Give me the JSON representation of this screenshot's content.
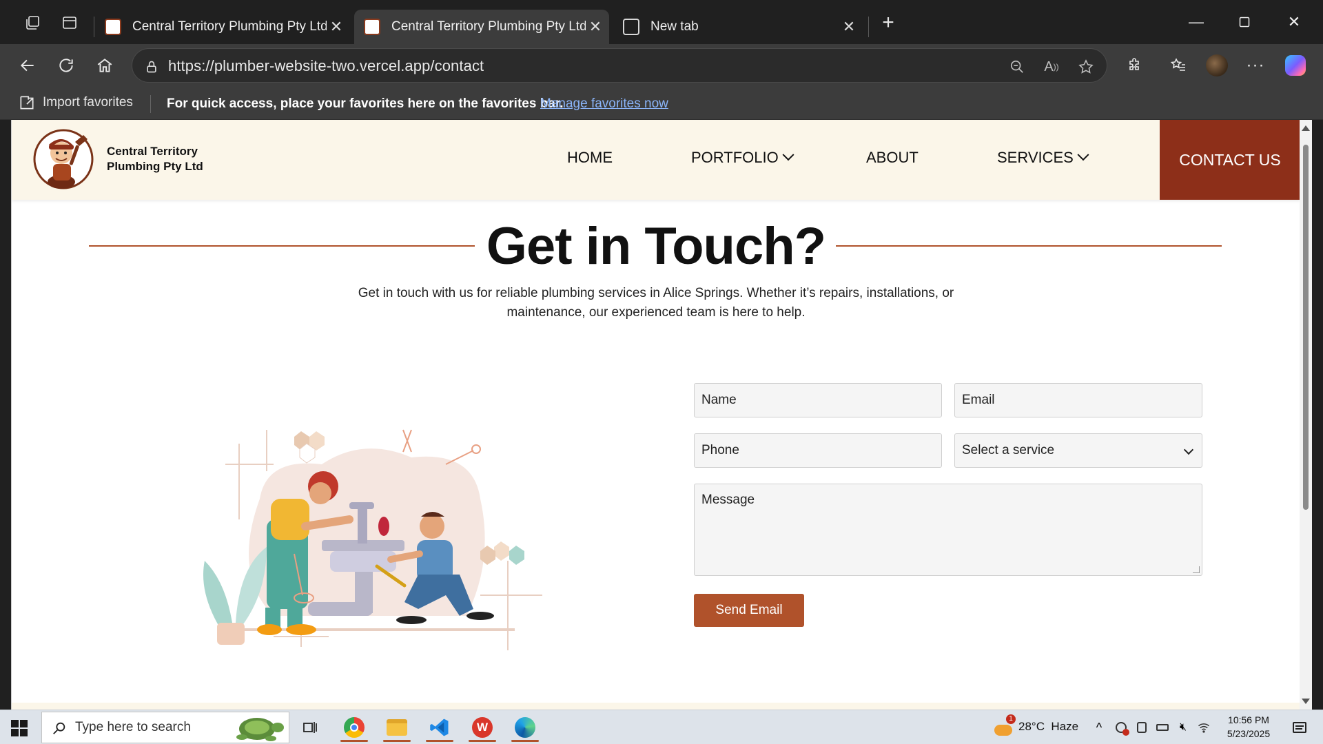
{
  "browser": {
    "tabs": [
      {
        "title": "Central Territory Plumbing Pty Ltd",
        "active": false
      },
      {
        "title": "Central Territory Plumbing Pty Ltd",
        "active": true
      },
      {
        "title": "New tab",
        "active": false
      }
    ],
    "url": "https://plumber-website-two.vercel.app/contact",
    "favorites_bar": {
      "import_label": "Import favorites",
      "hint": "For quick access, place your favorites here on the favorites bar.",
      "manage_link": "Manage favorites now"
    }
  },
  "site": {
    "brand_name_line1": "Central Territory",
    "brand_name_line2": "Plumbing Pty Ltd",
    "nav": {
      "home": "HOME",
      "portfolio": "PORTFOLIO",
      "about": "ABOUT",
      "services": "SERVICES",
      "contact": "CONTACT US"
    },
    "heading": "Get in Touch?",
    "description": "Get in touch with us for reliable plumbing services in Alice Springs. Whether it’s repairs, installations, or maintenance, our experienced team is here to help.",
    "form": {
      "name_placeholder": "Name",
      "email_placeholder": "Email",
      "phone_placeholder": "Phone",
      "service_selected": "Select a service",
      "message_placeholder": "Message",
      "submit_label": "Send Email"
    }
  },
  "taskbar": {
    "search_placeholder": "Type here to search",
    "weather": "28°C  Haze",
    "time": "10:56 PM",
    "date": "5/23/2025",
    "weather_badge": "1"
  },
  "colors": {
    "accent": "#b0522b",
    "contact_bg": "#8d2f19",
    "header_bg": "#fbf6e9"
  }
}
